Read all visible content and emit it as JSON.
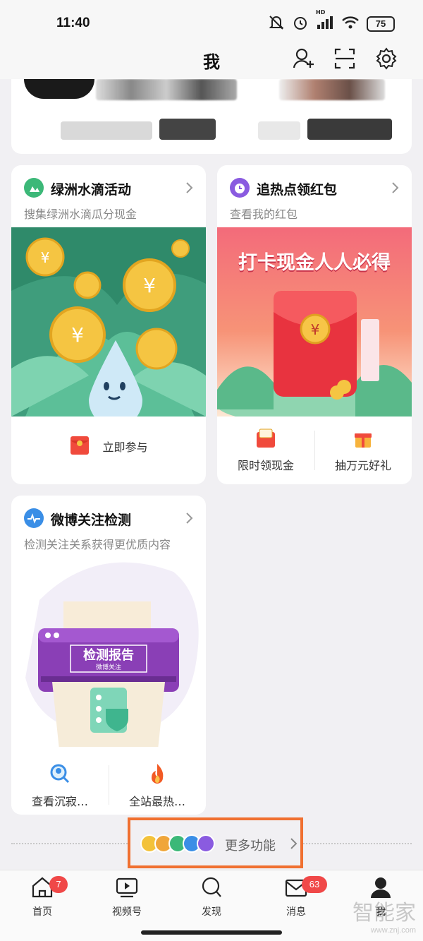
{
  "status_bar": {
    "time": "11:40",
    "battery": "75",
    "network": "HD"
  },
  "header": {
    "title": "我"
  },
  "cards": {
    "oasis": {
      "title": "绿洲水滴活动",
      "subtitle": "搜集绿洲水滴瓜分现金",
      "action": "立即参与",
      "accent": "#3cb878"
    },
    "hongbao": {
      "title": "追热点领红包",
      "subtitle": "查看我的红包",
      "banner_text": "打卡现金人人必得",
      "actions": [
        "限时领现金",
        "抽万元好礼"
      ],
      "accent": "#8a5be0"
    },
    "weibo_check": {
      "title": "微博关注检测",
      "subtitle": "检测关注关系获得更优质内容",
      "report_title": "检测报告",
      "report_sub": "微博关注",
      "actions": [
        "查看沉寂…",
        "全站最热…"
      ],
      "accent": "#3a8ee6"
    }
  },
  "more": {
    "label": "更多功能"
  },
  "tabbar": {
    "items": [
      {
        "label": "首页",
        "badge": "7",
        "icon": "home-icon"
      },
      {
        "label": "视频号",
        "badge": "",
        "icon": "video-icon"
      },
      {
        "label": "发现",
        "badge": "",
        "icon": "search-icon"
      },
      {
        "label": "消息",
        "badge": "63",
        "icon": "mail-icon"
      },
      {
        "label": "我",
        "badge": "",
        "icon": "user-icon"
      }
    ]
  },
  "watermark": {
    "text": "智能家",
    "url": "www.znj.com"
  },
  "colors": {
    "highlight_box": "#f07030",
    "badge": "#f04848"
  }
}
